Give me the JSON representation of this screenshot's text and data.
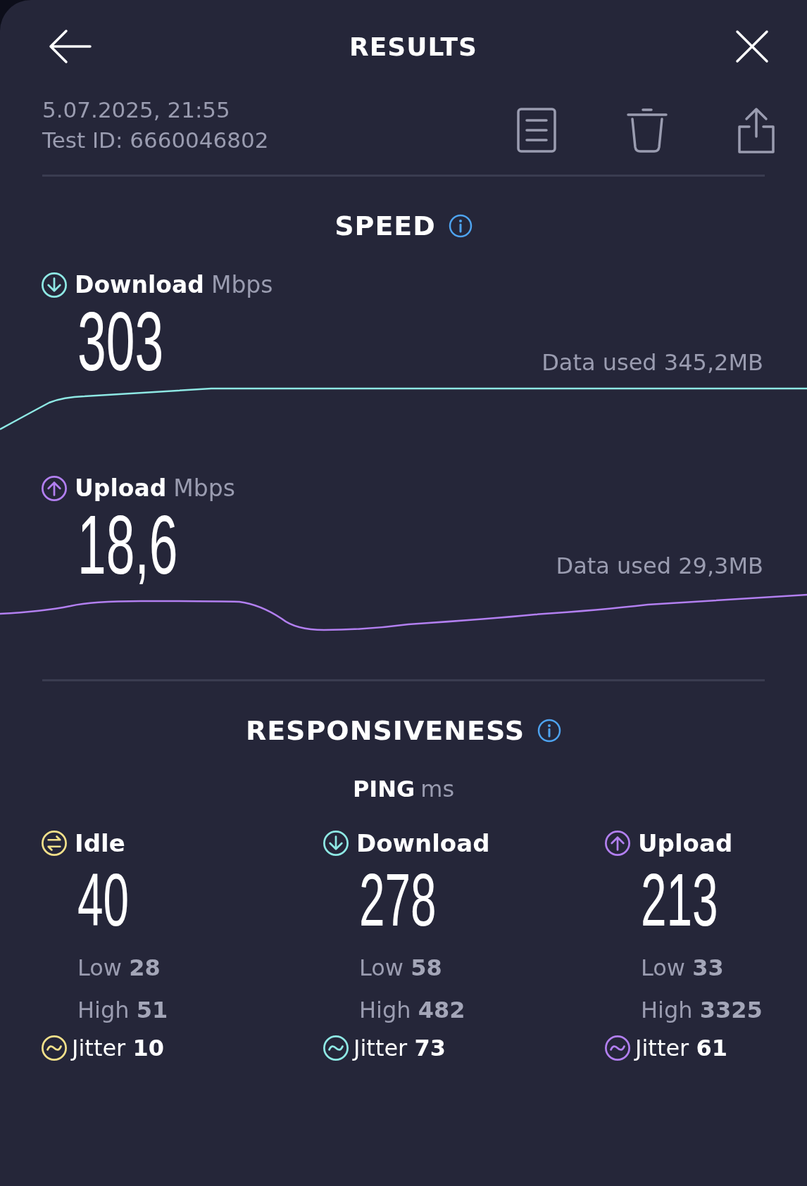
{
  "header": {
    "title": "RESULTS"
  },
  "test": {
    "date": "5.07.2025, 21:55",
    "test_id": "Test ID: 6660046802"
  },
  "speed": {
    "title": "SPEED",
    "tests": [
      {
        "kind": "download",
        "label": "Download",
        "unit": "Mbps",
        "value": "303",
        "data_used": "Data used 345,2MB"
      },
      {
        "kind": "upload",
        "label": "Upload",
        "unit": "Mbps",
        "value": "18,6",
        "data_used": "Data used 29,3MB"
      }
    ]
  },
  "responsiveness": {
    "title": "RESPONSIVENESS",
    "ping_label": "PING",
    "ping_unit": "ms",
    "columns": [
      {
        "kind": "idle",
        "label": "Idle",
        "color": "#f3e08a",
        "value": "40",
        "low": "Low **28**",
        "high": "High **51**",
        "jitter": "Jitter **10**"
      },
      {
        "kind": "download",
        "label": "Download",
        "color": "#8ee8e4",
        "value": "278",
        "low": "Low **58**",
        "high": "High **482**",
        "jitter": "Jitter **73**"
      },
      {
        "kind": "upload",
        "label": "Upload",
        "color": "#b27ff0",
        "value": "213",
        "low": "Low **33**",
        "high": "High **3325**",
        "jitter": "Jitter **61**"
      }
    ]
  }
}
